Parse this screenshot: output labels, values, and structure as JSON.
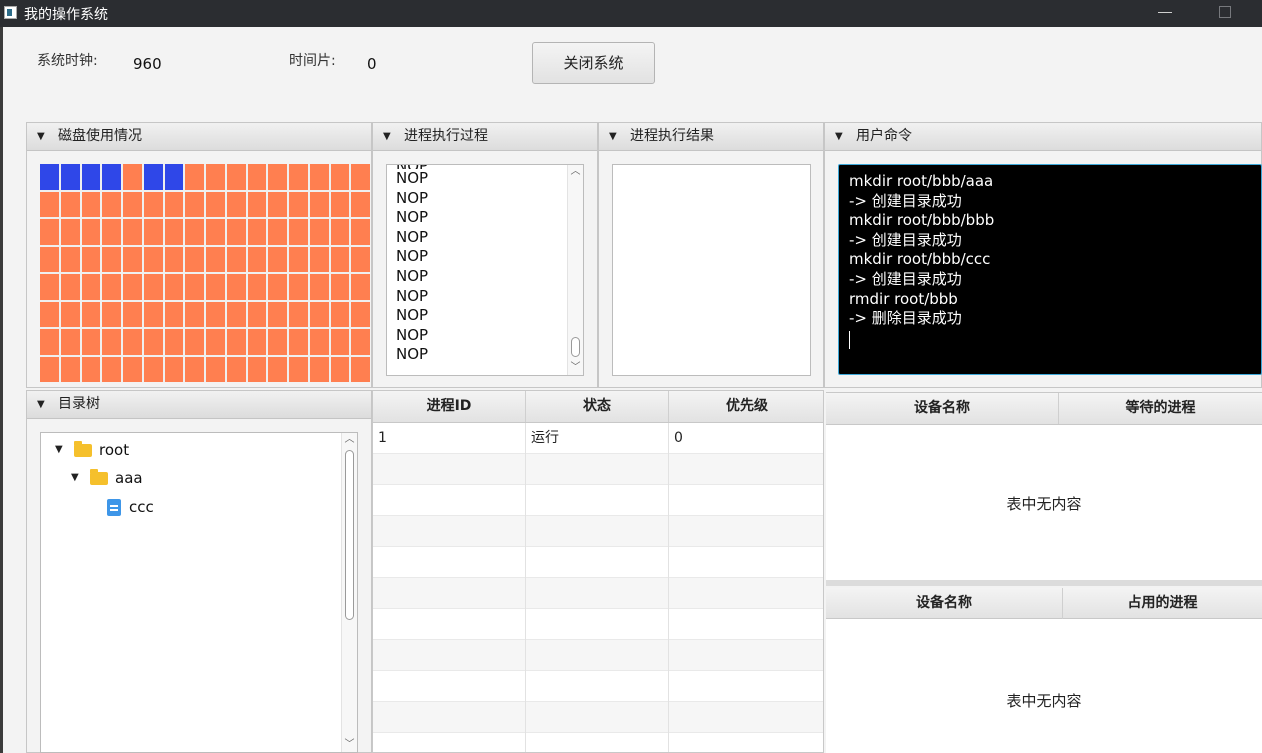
{
  "window": {
    "title": "我的操作系统",
    "min_glyph": "—",
    "max_glyph": "□"
  },
  "info": {
    "clock_label": "系统时钟:",
    "clock_value": "960",
    "slice_label": "时间片:",
    "slice_value": "0",
    "close_button": "关闭系统"
  },
  "disk": {
    "title": "磁盘使用情况",
    "columns": 16,
    "rows": 8,
    "used_blocks": [
      0,
      1,
      2,
      3,
      5,
      6
    ],
    "colors": {
      "used": "#2f47e8",
      "free": "#ff7f50"
    }
  },
  "process_exec": {
    "title": "进程执行过程",
    "lines": [
      "NOP",
      "NOP",
      "NOP",
      "NOP",
      "NOP",
      "NOP",
      "NOP",
      "NOP",
      "NOP",
      "NOP"
    ]
  },
  "process_result": {
    "title": "进程执行结果",
    "lines": []
  },
  "user_command": {
    "title": "用户命令",
    "lines": [
      "mkdir root/bbb/aaa",
      "-> 创建目录成功",
      "mkdir root/bbb/bbb",
      "-> 创建目录成功",
      "mkdir root/bbb/ccc",
      "-> 创建目录成功",
      "rmdir root/bbb",
      "-> 删除目录成功"
    ]
  },
  "dir_tree": {
    "title": "目录树",
    "root": {
      "label": "root",
      "icon": "folder-icon"
    },
    "child": {
      "label": "aaa",
      "icon": "folder-icon"
    },
    "leaf": {
      "label": "ccc",
      "icon": "file-icon"
    }
  },
  "process_table": {
    "headers": [
      "进程ID",
      "状态",
      "优先级"
    ],
    "rows": [
      [
        "1",
        "运行",
        "0"
      ]
    ]
  },
  "device_wait_table": {
    "headers": [
      "设备名称",
      "等待的进程"
    ],
    "empty_text": "表中无内容"
  },
  "device_occupy_table": {
    "headers": [
      "设备名称",
      "占用的进程"
    ],
    "empty_text": "表中无内容"
  }
}
